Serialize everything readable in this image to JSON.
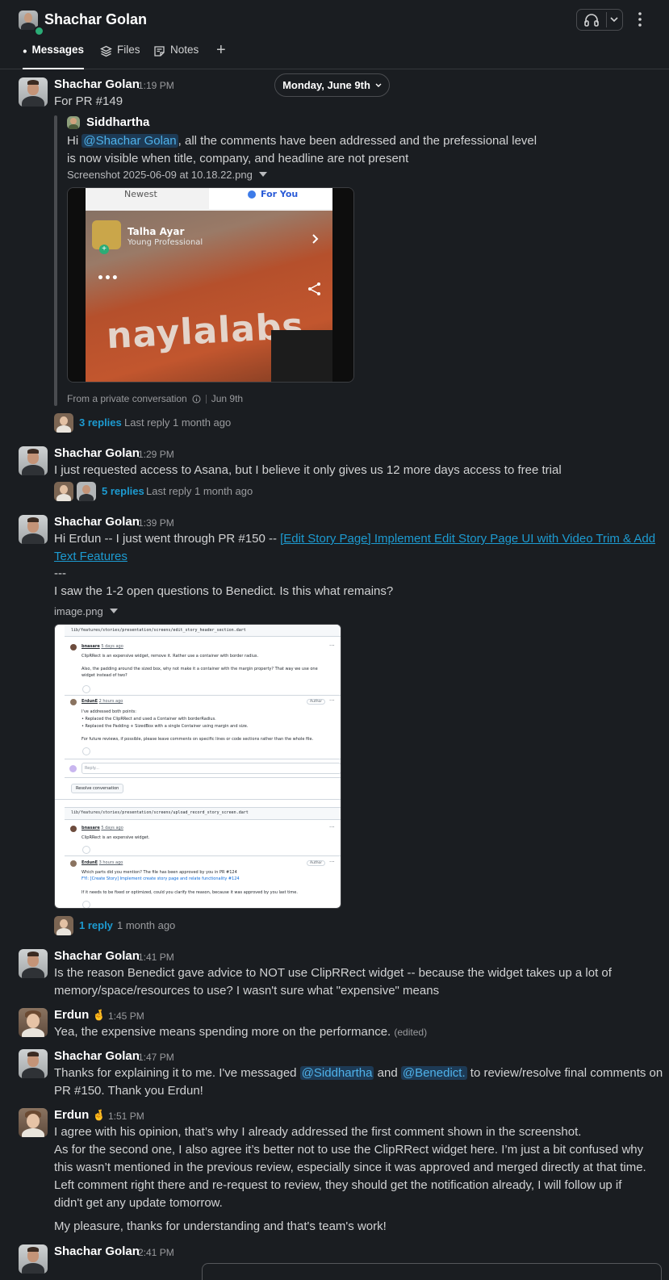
{
  "header": {
    "title": "Shachar Golan",
    "tabs": [
      {
        "label": "Messages",
        "active": true
      },
      {
        "label": "Files",
        "active": false
      },
      {
        "label": "Notes",
        "active": false
      }
    ],
    "add_tab": "+"
  },
  "date_divider": "Monday, June 9th",
  "messages": [
    {
      "author": "Shachar Golan",
      "time": "1:19 PM",
      "text": "For PR #149",
      "shared": {
        "author": "Siddhartha",
        "line1_pre": "Hi ",
        "mention": "@Shachar Golan",
        "line1_post": ", all the comments have been addressed and the prefessional level",
        "line2": "is now visible when title, company, and headline are not present",
        "file_name": "Screenshot 2025-06-09 at 10.18.22.png",
        "footer_from": "From a private conversation",
        "footer_date": "Jun 9th",
        "image": {
          "tab_newest": "Newest",
          "tab_for_you": "For You",
          "person_name": "Talha Ayar",
          "person_title": "Young Professional",
          "brand": "naylalabs"
        }
      },
      "replies": "3 replies",
      "last_reply": "Last reply 1 month ago"
    },
    {
      "author": "Shachar Golan",
      "time": "1:29 PM",
      "text": "I just requested access to Asana, but I believe it only gives us 12 more days access to free trial",
      "replies": "5 replies",
      "last_reply": "Last reply 1 month ago"
    },
    {
      "author": "Shachar Golan",
      "time": "1:39 PM",
      "line1_pre": "Hi Erdun -- I just went through PR #150 -- ",
      "link_part1": "[Edit Story Page] Implement Edit Story Page UI with Video Trim & Add",
      "link_part2": "Text Features",
      "line3": "---",
      "line4": "I saw the 1-2 open questions to Benedict. Is this what remains?",
      "file_name": "image.png",
      "image": {
        "file1_path": "lib/features/stories/presentation/screens/edit_story_header_section.dart",
        "c1_user": "bnasare",
        "c1_time": "5 days ago",
        "c1_l1": "ClipRRect is an expensive widget, remove it. Rather use a container with border radius.",
        "c1_l2": "Also, the padding around the sized box, why not make it a container with the margin property? That way we use one",
        "c1_l3": "widget instead of two?",
        "c2_user": "ErdunE",
        "c2_time": "2 hours ago",
        "author_badge": "Author",
        "c2_l1": "I've addressed both points:",
        "c2_l2": "• Replaced the ClipRRect and used a Container with borderRadius.",
        "c2_l3": "• Replaced the Padding + SizedBox with a single Container using margin and size.",
        "c2_l4": "For future reviews, if possible, please leave comments on specific lines or code sections rather than the whole file.",
        "reply_placeholder": "Reply...",
        "resolve": "Resolve conversation",
        "file2_path": "lib/features/stories/presentation/screens/upload_record_story_screen.dart",
        "c3_user": "bnasare",
        "c3_time": "5 days ago",
        "c3_l1": "ClipRRect is an expensive widget.",
        "c4_user": "ErdunE",
        "c4_time": "3 hours ago",
        "c4_l1": "Which parts did you mention? The file has been approved by you in PR #124",
        "c4_l2": "FYI: [Create Story] Implement create story page and relate functionality #124",
        "c4_l3": "If it needs to be fixed or optimized, could you clarify the reason, because it was approved by you last time."
      },
      "replies": "1 reply",
      "last_reply": "1 month ago"
    },
    {
      "author": "Shachar Golan",
      "time": "1:41 PM",
      "line1": "Is the reason Benedict gave advice to NOT use ClipRRect widget -- because the widget takes up a lot of",
      "line2": "memory/space/resources to use? I wasn't sure what \"expensive\" means"
    },
    {
      "author": "Erdun",
      "emoji": "🤞",
      "time": "1:45 PM",
      "text": "Yea, the expensive means spending more on the performance.",
      "edited": "(edited)"
    },
    {
      "author": "Shachar Golan",
      "time": "1:47 PM",
      "line1_pre": "Thanks for explaining it to me. I've messaged ",
      "mention1": "@Siddhartha",
      "mid": " and ",
      "mention2": "@Benedict.",
      "line1_post": " to review/resolve final comments on",
      "line2": "PR #150. Thank you Erdun!"
    },
    {
      "author": "Erdun",
      "emoji": "🤞",
      "time": "1:51 PM",
      "line1": "I agree with his opinion, that’s why I already addressed the first comment shown in the screenshot.",
      "line2": "As for the second one, I also agree it’s better not to use the ClipRRect widget here. I’m just a bit confused why",
      "line3": "this wasn’t mentioned in the previous review, especially since it was approved and merged directly at that time.",
      "line4": "Left comment right there and re-request to review, they should get the notification already, I will follow up if",
      "line5": "didn't get any update tomorrow.",
      "line6": "My pleasure, thanks for understanding and that's team's work!"
    },
    {
      "author": "Shachar Golan",
      "time": "2:41 PM"
    }
  ],
  "icons": {
    "header": [
      "avatar",
      "presence-dot",
      "headphones-icon",
      "chevron-down-icon",
      "kebab-menu-icon"
    ],
    "tabs": [
      "message-icon",
      "files-icon",
      "notes-icon",
      "plus-icon"
    ],
    "misc": [
      "info-icon",
      "caret-down-icon",
      "share-icon"
    ]
  },
  "colors": {
    "background": "#1a1d21",
    "link": "#1d9bd1",
    "mention_bg": "#1d3a55",
    "presence": "#2bac76"
  }
}
